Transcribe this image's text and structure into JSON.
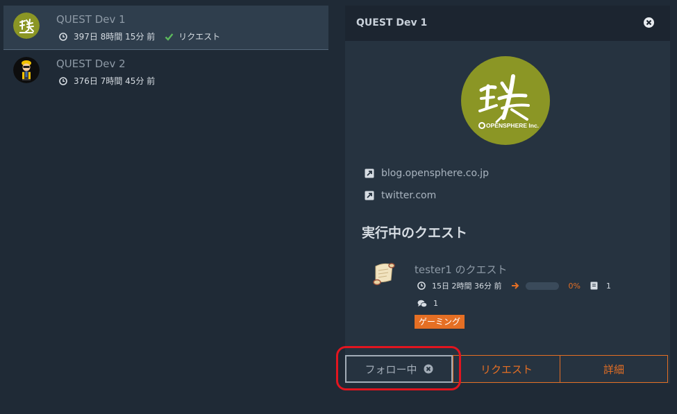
{
  "list": {
    "items": [
      {
        "name": "QUEST Dev 1",
        "time": "397日 8時間 15分 前",
        "status": "リクエスト",
        "selected": true
      },
      {
        "name": "QUEST Dev 2",
        "time": "376日 7時間 45分 前"
      }
    ]
  },
  "panel": {
    "title": "QUEST Dev 1",
    "links": [
      "blog.opensphere.co.jp",
      "twitter.com"
    ],
    "section_title": "実行中のクエスト",
    "quest": {
      "name": "tester1 のクエスト",
      "time": "15日 2時間 36分 前",
      "progress_percent": 0,
      "progress_label": "0%",
      "documents": "1",
      "comments": "1",
      "tag": "ゲーミング"
    },
    "actions": {
      "follow_label": "フォロー中",
      "request_label": "リクエスト",
      "detail_label": "詳細"
    }
  },
  "logo": {
    "wordmark": "OPENSPHERE Inc."
  },
  "colors": {
    "background": "#1f2a36",
    "panel": "#263340",
    "accent": "#e56f24",
    "logo_green": "#8b9625",
    "highlight": "#e2151f"
  },
  "icons": [
    "clock-icon",
    "check-icon",
    "close-icon",
    "external-link-icon",
    "arrow-right-icon",
    "document-icon",
    "comments-icon"
  ]
}
